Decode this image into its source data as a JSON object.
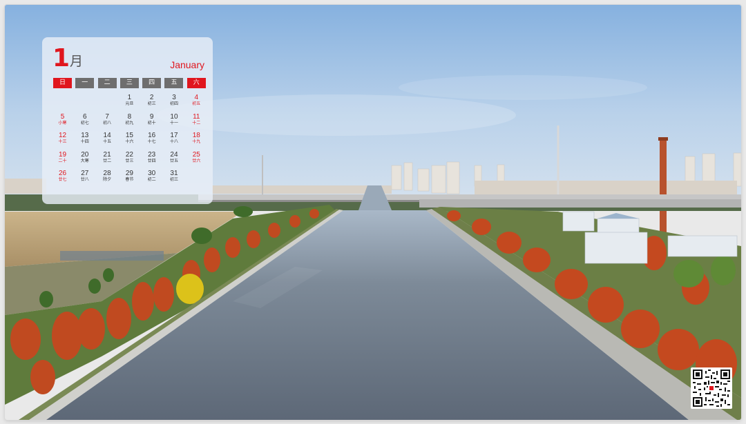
{
  "calendar": {
    "month_number": "1",
    "month_char": "月",
    "month_en": "January",
    "weekdays": [
      "日",
      "一",
      "二",
      "三",
      "四",
      "五",
      "六"
    ],
    "days": [
      {
        "num": "",
        "lunar": ""
      },
      {
        "num": "",
        "lunar": ""
      },
      {
        "num": "",
        "lunar": ""
      },
      {
        "num": "1",
        "lunar": "元旦"
      },
      {
        "num": "2",
        "lunar": "初三"
      },
      {
        "num": "3",
        "lunar": "初四"
      },
      {
        "num": "4",
        "lunar": "初五"
      },
      {
        "num": "5",
        "lunar": "小寒"
      },
      {
        "num": "6",
        "lunar": "初七"
      },
      {
        "num": "7",
        "lunar": "初八"
      },
      {
        "num": "8",
        "lunar": "初九"
      },
      {
        "num": "9",
        "lunar": "初十"
      },
      {
        "num": "10",
        "lunar": "十一"
      },
      {
        "num": "11",
        "lunar": "十二"
      },
      {
        "num": "12",
        "lunar": "十三"
      },
      {
        "num": "13",
        "lunar": "十四"
      },
      {
        "num": "14",
        "lunar": "十五"
      },
      {
        "num": "15",
        "lunar": "十六"
      },
      {
        "num": "16",
        "lunar": "十七"
      },
      {
        "num": "17",
        "lunar": "十八"
      },
      {
        "num": "18",
        "lunar": "十九"
      },
      {
        "num": "19",
        "lunar": "二十"
      },
      {
        "num": "20",
        "lunar": "大寒"
      },
      {
        "num": "21",
        "lunar": "廿二"
      },
      {
        "num": "22",
        "lunar": "廿三"
      },
      {
        "num": "23",
        "lunar": "廿四"
      },
      {
        "num": "24",
        "lunar": "廿五"
      },
      {
        "num": "25",
        "lunar": "廿六"
      },
      {
        "num": "26",
        "lunar": "廿七"
      },
      {
        "num": "27",
        "lunar": "廿八"
      },
      {
        "num": "28",
        "lunar": "除夕"
      },
      {
        "num": "29",
        "lunar": "春节"
      },
      {
        "num": "30",
        "lunar": "初二"
      },
      {
        "num": "31",
        "lunar": "初三"
      }
    ]
  },
  "colors": {
    "accent_red": "#e0161e",
    "weekday_header_gray": "#6e6e6e",
    "autumn_tree": "#c44a22",
    "water": "#6f7c8c",
    "sky": "#9fc2e4"
  }
}
